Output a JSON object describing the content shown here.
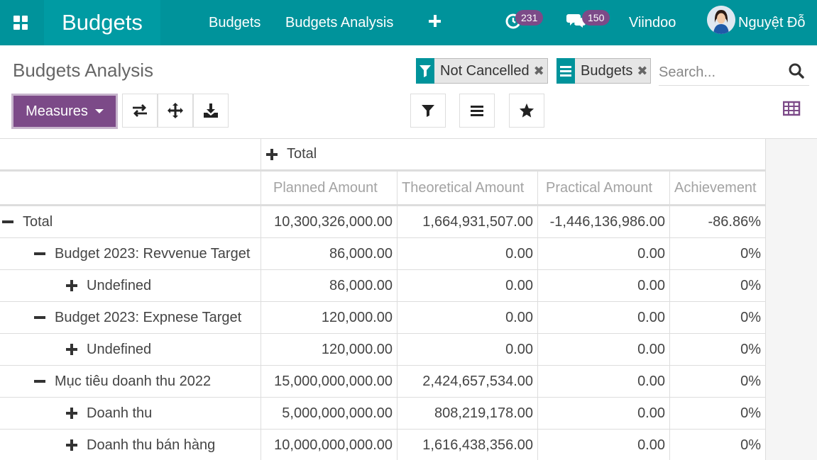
{
  "navbar": {
    "app_title": "Budgets",
    "menu": [
      "Budgets",
      "Budgets Analysis"
    ],
    "activity_count": "231",
    "message_count": "150",
    "company": "Viindoo",
    "user_name": "Nguyệt Đỗ",
    "icons": [
      "apps-icon",
      "plus-icon",
      "clock-icon",
      "chat-icon"
    ]
  },
  "breadcrumb": "Budgets Analysis",
  "search": {
    "facets": [
      {
        "icon": "filter-icon",
        "label": "Not Cancelled"
      },
      {
        "icon": "group-by-icon",
        "label": "Budgets"
      }
    ],
    "placeholder": "Search..."
  },
  "toolbar": {
    "measures_label": "Measures",
    "buttons": [
      "flip-axis-icon",
      "expand-all-icon",
      "download-icon"
    ],
    "search_panel_buttons": [
      "filter-icon",
      "group-by-icon",
      "favorite-star-icon"
    ],
    "view": "pivot-view-icon"
  },
  "colors": {
    "navbar": "#00939b",
    "brand": "#7c4a88",
    "badge": "#7c4a88"
  },
  "pivot": {
    "col_group_header": "Total",
    "measures": [
      "Planned Amount",
      "Theoretical Amount",
      "Practical Amount",
      "Achievement"
    ],
    "rows": [
      {
        "label": "Total",
        "level": 0,
        "expanded": true,
        "values": [
          "10,300,326,000.00",
          "1,664,931,507.00",
          "-1,446,136,986.00",
          "-86.86%"
        ]
      },
      {
        "label": "Budget 2023: Revvenue Target",
        "level": 1,
        "expanded": true,
        "values": [
          "86,000.00",
          "0.00",
          "0.00",
          "0%"
        ]
      },
      {
        "label": "Undefined",
        "level": 2,
        "expanded": false,
        "values": [
          "86,000.00",
          "0.00",
          "0.00",
          "0%"
        ]
      },
      {
        "label": "Budget 2023: Expnese Target",
        "level": 1,
        "expanded": true,
        "values": [
          "120,000.00",
          "0.00",
          "0.00",
          "0%"
        ]
      },
      {
        "label": "Undefined",
        "level": 2,
        "expanded": false,
        "values": [
          "120,000.00",
          "0.00",
          "0.00",
          "0%"
        ]
      },
      {
        "label": "Mục tiêu doanh thu 2022",
        "level": 1,
        "expanded": true,
        "values": [
          "15,000,000,000.00",
          "2,424,657,534.00",
          "0.00",
          "0%"
        ]
      },
      {
        "label": "Doanh thu",
        "level": 2,
        "expanded": false,
        "values": [
          "5,000,000,000.00",
          "808,219,178.00",
          "0.00",
          "0%"
        ]
      },
      {
        "label": "Doanh thu bán hàng",
        "level": 2,
        "expanded": false,
        "values": [
          "10,000,000,000.00",
          "1,616,438,356.00",
          "0.00",
          "0%"
        ]
      }
    ]
  }
}
